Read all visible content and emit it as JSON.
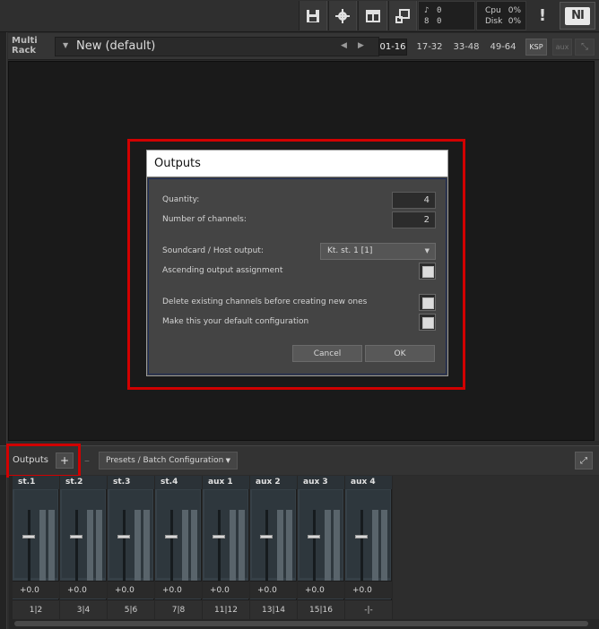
{
  "topbar": {
    "save_icon": "save-icon",
    "settings_icon": "gear-icon",
    "view_icon": "layout-icon",
    "resize_icon": "resize-icon",
    "midi_in": "0",
    "audio_out": "0",
    "cpu_label": "Cpu",
    "cpu_value": "0%",
    "disk_label": "Disk",
    "disk_value": "0%",
    "warning": "!",
    "logo": "NI"
  },
  "rack": {
    "label_line1": "Multi",
    "label_line2": "Rack",
    "instrument_name": "New (default)",
    "pages": [
      "01-16",
      "17-32",
      "33-48",
      "49-64"
    ],
    "active_page": "01-16",
    "ksp_label": "KSP",
    "aux_label": "aux"
  },
  "dialog": {
    "title": "Outputs",
    "quantity_label": "Quantity:",
    "quantity_value": "4",
    "channels_label": "Number of channels:",
    "channels_value": "2",
    "soundcard_label": "Soundcard / Host output:",
    "soundcard_value": "Kt. st. 1 [1]",
    "ascending_label": "Ascending output assignment",
    "delete_label": "Delete existing channels before creating new ones",
    "default_label": "Make this your default configuration",
    "cancel_label": "Cancel",
    "ok_label": "OK"
  },
  "outputs": {
    "title": "Outputs",
    "add_label": "+",
    "remove_label": "–",
    "presets_label": "Presets / Batch Configuration",
    "channels": [
      {
        "name": "st.1",
        "volume": "+0.0",
        "routing": "1|2"
      },
      {
        "name": "st.2",
        "volume": "+0.0",
        "routing": "3|4"
      },
      {
        "name": "st.3",
        "volume": "+0.0",
        "routing": "5|6"
      },
      {
        "name": "st.4",
        "volume": "+0.0",
        "routing": "7|8"
      },
      {
        "name": "aux 1",
        "volume": "+0.0",
        "routing": "11|12"
      },
      {
        "name": "aux 2",
        "volume": "+0.0",
        "routing": "13|14"
      },
      {
        "name": "aux 3",
        "volume": "+0.0",
        "routing": "15|16"
      },
      {
        "name": "aux 4",
        "volume": "+0.0",
        "routing": "-|-"
      }
    ]
  }
}
